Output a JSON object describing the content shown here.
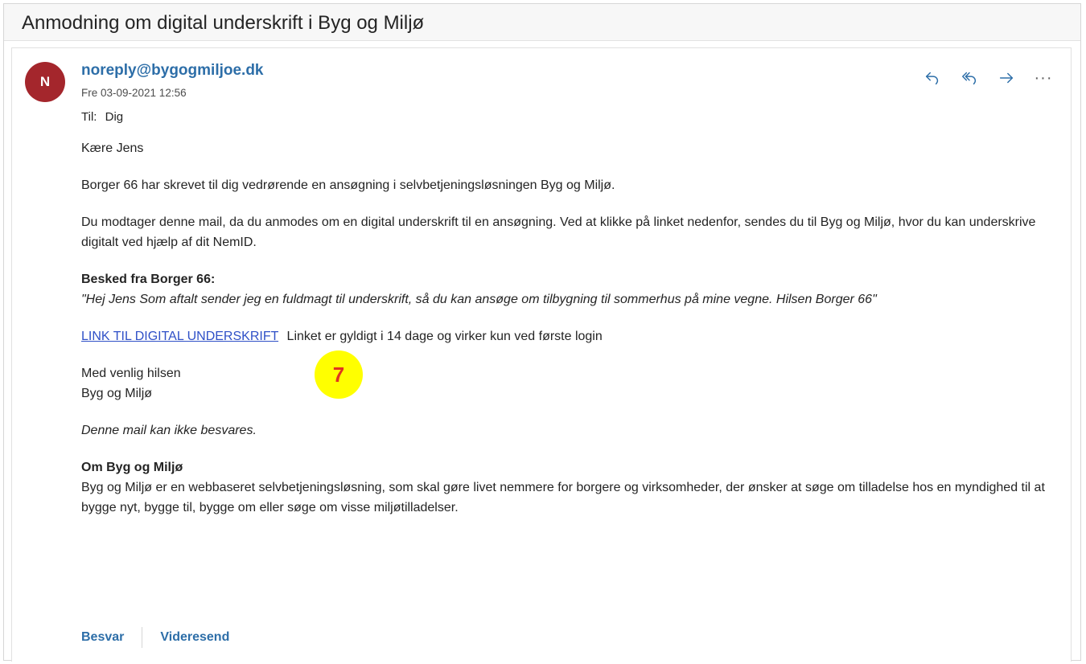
{
  "email": {
    "subject": "Anmodning om digital underskrift i Byg og Miljø",
    "avatar_initial": "N",
    "sender": "noreply@bygogmiljoe.dk",
    "date": "Fre 03-09-2021 12:56",
    "to_label": "Til:",
    "to_value": "Dig",
    "actions": {
      "reply_icon": "reply-icon",
      "reply_all_icon": "reply-all-icon",
      "forward_icon": "forward-icon",
      "more_icon": "more-icon",
      "more_glyph": "···"
    }
  },
  "body": {
    "greeting": "Kære Jens",
    "para1": "Borger 66 har skrevet til dig vedrørende en ansøgning i selvbetjeningsløsningen Byg og Miljø.",
    "para2": "Du modtager denne mail, da du anmodes om en digital underskrift til en ansøgning. Ved at klikke på linket nedenfor, sendes du til Byg og Miljø, hvor du kan underskrive digitalt ved hjælp af dit NemID.",
    "message_heading": "Besked fra Borger 66:",
    "message_text": "\"Hej Jens Som aftalt sender jeg en fuldmagt til underskrift, så du kan ansøge om tilbygning til sommerhus på mine vegne. Hilsen Borger 66\"",
    "link_text": "LINK TIL DIGITAL UNDERSKRIFT",
    "link_note": "Linket er gyldigt i 14 dage og virker kun ved første login",
    "closing_1": "Med venlig hilsen",
    "closing_2": "Byg og Miljø",
    "no_reply": "Denne mail kan ikke besvares.",
    "about_heading": "Om Byg og Miljø",
    "about_text": "Byg og Miljø er en webbaseret selvbetjeningsløsning, som skal gøre livet nemmere for borgere og virksomheder, der ønsker at søge om tilladelse hos en myndighed til at bygge nyt, bygge til, bygge om eller søge om visse miljøtilladelser."
  },
  "annotation": {
    "badge_number": "7",
    "badge_color": "#ffff00",
    "badge_text_color": "#e03420"
  },
  "footer": {
    "reply_label": "Besvar",
    "forward_label": "Videresend"
  },
  "colors": {
    "accent": "#2d6ea8",
    "link": "#2f50c7",
    "avatar": "#a4262c"
  }
}
